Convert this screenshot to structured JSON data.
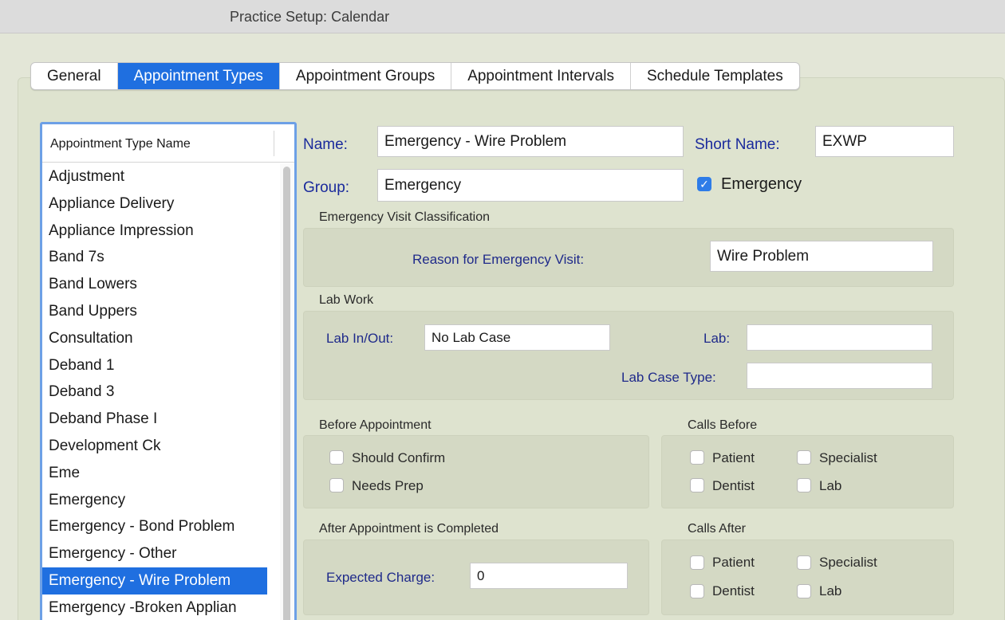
{
  "window": {
    "title": "Practice Setup: Calendar"
  },
  "tabs": [
    {
      "label": "General"
    },
    {
      "label": "Appointment Types"
    },
    {
      "label": "Appointment Groups"
    },
    {
      "label": "Appointment Intervals"
    },
    {
      "label": "Schedule Templates"
    }
  ],
  "list": {
    "header": "Appointment Type Name",
    "items": [
      "Adjustment",
      "Appliance Delivery",
      "Appliance Impression",
      "Band 7s",
      "Band Lowers",
      "Band Uppers",
      "Consultation",
      "Deband 1",
      "Deband 3",
      "Deband Phase I",
      "Development Ck",
      "Eme",
      "Emergency",
      "Emergency - Bond Problem",
      "Emergency - Other",
      "Emergency - Wire Problem",
      "Emergency -Broken Applian"
    ],
    "selected": "Emergency - Wire Problem"
  },
  "form": {
    "name_label": "Name:",
    "name_value": "Emergency - Wire Problem",
    "short_name_label": "Short Name:",
    "short_name_value": "EXWP",
    "group_label": "Group:",
    "group_value": "Emergency",
    "emergency_checkbox_label": "Emergency",
    "emergency_checked": true,
    "emergency_section_title": "Emergency Visit Classification",
    "reason_label": "Reason for Emergency Visit:",
    "reason_value": "Wire Problem",
    "lab_section_title": "Lab Work",
    "lab_inout_label": "Lab In/Out:",
    "lab_inout_value": "No Lab Case",
    "lab_label": "Lab:",
    "lab_value": "",
    "lab_case_type_label": "Lab Case Type:",
    "lab_case_type_value": "",
    "before_title": "Before Appointment",
    "should_confirm": "Should Confirm",
    "needs_prep": "Needs Prep",
    "calls_before_title": "Calls Before",
    "after_title": "After Appointment is Completed",
    "expected_charge_label": "Expected Charge:",
    "expected_charge_value": "0",
    "calls_after_title": "Calls After",
    "patient": "Patient",
    "specialist": "Specialist",
    "dentist": "Dentist",
    "lab": "Lab"
  },
  "colors": {
    "accent": "#1f6fe0",
    "panel": "#dee3cf",
    "label_blue": "#1a2a9c"
  }
}
